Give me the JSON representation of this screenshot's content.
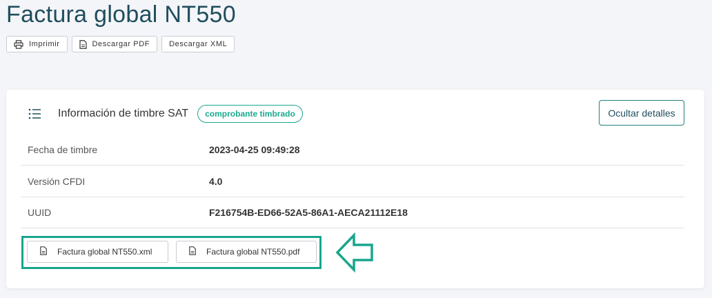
{
  "page": {
    "title": "Factura global NT550"
  },
  "toolbar": {
    "print_label": "Imprimir",
    "pdf_label": "Descargar PDF",
    "xml_label": "Descargar XML"
  },
  "card": {
    "title": "Información de timbre SAT",
    "badge": "comprobante timbrado",
    "hide_label": "Ocultar detalles",
    "rows": [
      {
        "label": "Fecha de timbre",
        "value": "2023-04-25 09:49:28"
      },
      {
        "label": "Versión CFDI",
        "value": "4.0"
      },
      {
        "label": "UUID",
        "value": "F216754B-ED66-52A5-86A1-AECA21112E18"
      }
    ],
    "files": [
      {
        "name": "Factura global NT550.xml",
        "icon": "file-icon"
      },
      {
        "name": "Factura global NT550.pdf",
        "icon": "file-icon"
      }
    ]
  },
  "colors": {
    "accent": "#19a58c",
    "title": "#1f4e5c",
    "background": "#f4f5f9"
  }
}
